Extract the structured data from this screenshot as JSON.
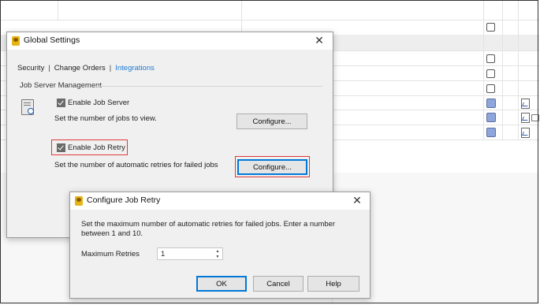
{
  "global_settings": {
    "title": "Global Settings",
    "close_glyph": "✕",
    "tabs": [
      {
        "label": "Security",
        "active": false
      },
      {
        "label": "Change Orders",
        "active": false
      },
      {
        "label": "Integrations",
        "active": true
      }
    ],
    "tab_separator": "|",
    "section_title": "Job Server Management",
    "enable_job_server": {
      "label": "Enable Job Server",
      "checked": true
    },
    "jobs_view_text": "Set the number of jobs to view.",
    "configure_label": "Configure...",
    "enable_job_retry": {
      "label": "Enable Job Retry",
      "checked": true
    },
    "retries_text": "Set the number of automatic retries for failed jobs",
    "configure_retry_label": "Configure..."
  },
  "configure_job_retry": {
    "title": "Configure Job Retry",
    "close_glyph": "✕",
    "description": "Set the maximum number of automatic retries for failed jobs. Enter a number between 1 and 10.",
    "max_retries_label": "Maximum Retries",
    "max_retries_value": "1",
    "ok_label": "OK",
    "cancel_label": "Cancel",
    "help_label": "Help"
  },
  "icons": {
    "app": "app-logo-icon",
    "server": "job-server-icon",
    "checkbox": "checkbox-icon",
    "doc": "document-image-icon"
  },
  "colors": {
    "accent": "#0078d7",
    "link": "#1f7ad0",
    "highlight": "#e0393a",
    "checked_box": "#8fa6dc"
  }
}
